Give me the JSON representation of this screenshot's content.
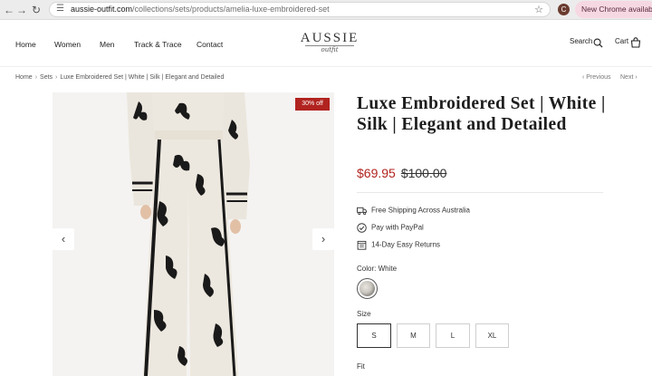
{
  "browser": {
    "url_host": "aussie-outfit.com",
    "url_path": "/collections/sets/products/amelia-luxe-embroidered-set",
    "profile_initial": "C",
    "update_label": "New Chrome available"
  },
  "header": {
    "nav": [
      "Home",
      "Women",
      "Men",
      "Track & Trace",
      "Contact"
    ],
    "logo_main": "AUSSIE",
    "logo_script": "outfit",
    "search_label": "Search",
    "cart_label": "Cart"
  },
  "breadcrumb": {
    "items": [
      "Home",
      "Sets",
      "Luxe Embroidered Set | White | Silk | Elegant and Detailed"
    ],
    "previous": "Previous",
    "next": "Next"
  },
  "gallery": {
    "badge": "30% off"
  },
  "product": {
    "title": "Luxe Embroidered Set | White | Silk | Elegant and Detailed",
    "price_sale": "$69.95",
    "price_original": "$100.00",
    "perks": [
      "Free Shipping Across Australia",
      "Pay with PayPal",
      "14-Day Easy Returns"
    ],
    "color_label": "Color: White",
    "size_label": "Size",
    "sizes": [
      "S",
      "M",
      "L",
      "XL"
    ],
    "fit_label": "Fit"
  },
  "colors": {
    "accent": "#b1231f",
    "badge_bg": "#b1231f",
    "update_pill": "#f6d8e3"
  }
}
